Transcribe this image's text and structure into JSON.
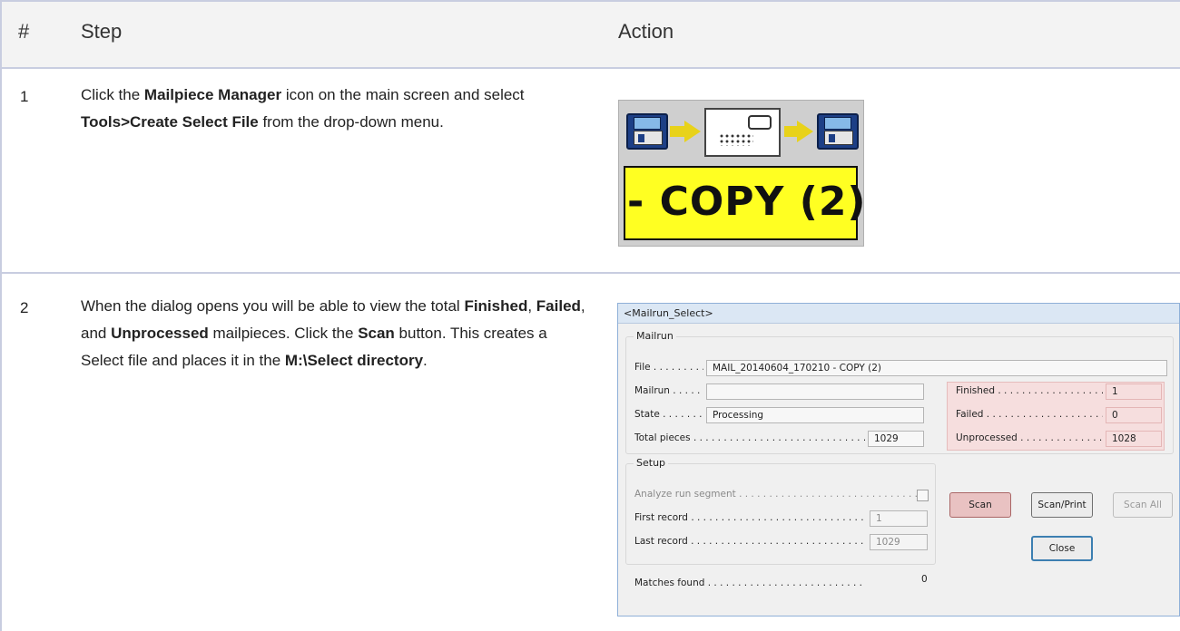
{
  "table": {
    "headers": {
      "num": "#",
      "step": "Step",
      "action": "Action"
    },
    "rows": [
      {
        "num": "1",
        "text": {
          "p1": "Click the ",
          "b1": "Mailpiece Manager",
          "p2": " icon on the main screen and select ",
          "b2": "Tools>Create Select File",
          "p3": " from the drop-down menu."
        },
        "image": {
          "caption": "- COPY (2)",
          "icons": [
            "floppy-disk-icon",
            "arrow-right-icon",
            "envelope-icon",
            "arrow-right-icon",
            "floppy-disk-icon"
          ]
        }
      },
      {
        "num": "2",
        "text": {
          "p1": "When the dialog opens you will be able to view the total ",
          "b1": "Finished",
          "p2": ", ",
          "b2": "Failed",
          "p3": ", and ",
          "b3": "Unprocessed",
          "p4": " mailpieces. Click the ",
          "b4": "Scan",
          "p5": " button. This creates a Select file and places it in the ",
          "b5": "M:\\Select directory",
          "p6": "."
        }
      }
    ]
  },
  "dialog": {
    "title": "<Mailrun_Select>",
    "mailrun_group": {
      "title": "Mailrun",
      "file_label": "File . . . . . . . . .",
      "file_value": "MAIL_20140604_170210 - COPY (2)",
      "mailrun_label": "Mailrun . . . . . .",
      "mailrun_value": "",
      "state_label": "State . . . . . . . .",
      "state_value": "Processing",
      "total_label": "Total pieces . . . . . . . . . . . . . . . . . . . . . . . . . . . . . .",
      "total_value": "1029",
      "finished_label": "Finished . . . . . . . . . . . . . . . . . . . .",
      "finished_value": "1",
      "failed_label": "Failed . . . . . . . . . . . . . . . . . . . . . .",
      "failed_value": "0",
      "unprocessed_label": "Unprocessed . . . . . . . . . . . . . . . .",
      "unprocessed_value": "1028"
    },
    "setup_group": {
      "title": "Setup",
      "analyze_label": "Analyze run segment . . . . . . . . . . . . . . . . . . . . . . . . . . . . . . .",
      "first_label": "First record . . . . . . . . . . . . . . . . . . . . . . . . . . . . . . . . .",
      "first_value": "1",
      "last_label": "Last record . . . . . . . . . . . . . . . . . . . . . . . . . . . . . . . . .",
      "last_value": "1029"
    },
    "buttons": {
      "scan": "Scan",
      "scan_print": "Scan/Print",
      "scan_all": "Scan All",
      "close": "Close"
    },
    "matches_label": "Matches found . . . . . . . . . . . . . . . . . . . . . . . . . . . . .",
    "matches_value": "0"
  }
}
